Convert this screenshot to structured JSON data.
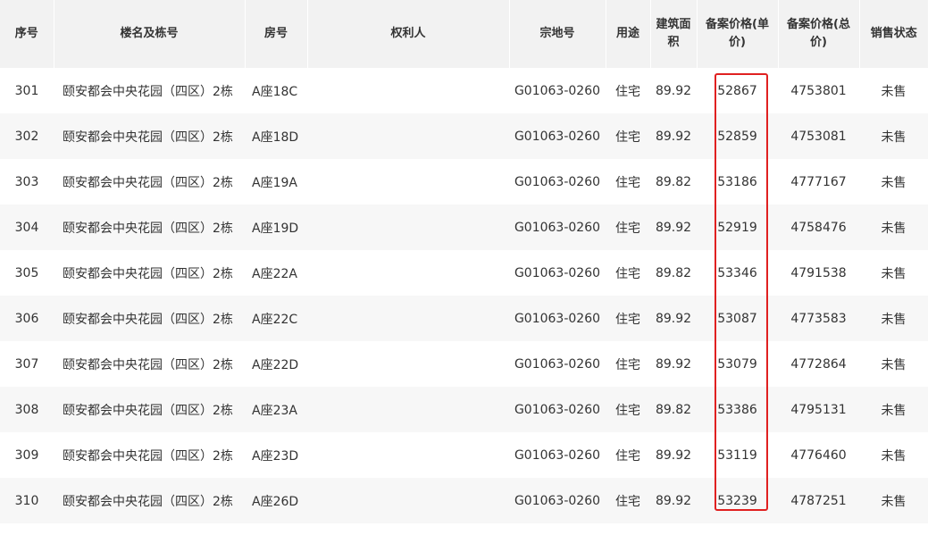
{
  "table": {
    "headers": {
      "seq": "序号",
      "building": "楼名及栋号",
      "room": "房号",
      "owner": "权利人",
      "parcel": "宗地号",
      "usage": "用途",
      "area": "建筑面积",
      "unit_price": "备案价格(单价)",
      "total_price": "备案价格(总价)",
      "status": "销售状态"
    },
    "rows": [
      {
        "seq": "301",
        "building": "颐安都会中央花园（四区）2栋",
        "room": "A座18C",
        "owner": "",
        "parcel": "G01063-0260",
        "usage": "住宅",
        "area": "89.92",
        "unit_price": "52867",
        "total_price": "4753801",
        "status": "未售"
      },
      {
        "seq": "302",
        "building": "颐安都会中央花园（四区）2栋",
        "room": "A座18D",
        "owner": "",
        "parcel": "G01063-0260",
        "usage": "住宅",
        "area": "89.92",
        "unit_price": "52859",
        "total_price": "4753081",
        "status": "未售"
      },
      {
        "seq": "303",
        "building": "颐安都会中央花园（四区）2栋",
        "room": "A座19A",
        "owner": "",
        "parcel": "G01063-0260",
        "usage": "住宅",
        "area": "89.82",
        "unit_price": "53186",
        "total_price": "4777167",
        "status": "未售"
      },
      {
        "seq": "304",
        "building": "颐安都会中央花园（四区）2栋",
        "room": "A座19D",
        "owner": "",
        "parcel": "G01063-0260",
        "usage": "住宅",
        "area": "89.92",
        "unit_price": "52919",
        "total_price": "4758476",
        "status": "未售"
      },
      {
        "seq": "305",
        "building": "颐安都会中央花园（四区）2栋",
        "room": "A座22A",
        "owner": "",
        "parcel": "G01063-0260",
        "usage": "住宅",
        "area": "89.82",
        "unit_price": "53346",
        "total_price": "4791538",
        "status": "未售"
      },
      {
        "seq": "306",
        "building": "颐安都会中央花园（四区）2栋",
        "room": "A座22C",
        "owner": "",
        "parcel": "G01063-0260",
        "usage": "住宅",
        "area": "89.92",
        "unit_price": "53087",
        "total_price": "4773583",
        "status": "未售"
      },
      {
        "seq": "307",
        "building": "颐安都会中央花园（四区）2栋",
        "room": "A座22D",
        "owner": "",
        "parcel": "G01063-0260",
        "usage": "住宅",
        "area": "89.92",
        "unit_price": "53079",
        "total_price": "4772864",
        "status": "未售"
      },
      {
        "seq": "308",
        "building": "颐安都会中央花园（四区）2栋",
        "room": "A座23A",
        "owner": "",
        "parcel": "G01063-0260",
        "usage": "住宅",
        "area": "89.82",
        "unit_price": "53386",
        "total_price": "4795131",
        "status": "未售"
      },
      {
        "seq": "309",
        "building": "颐安都会中央花园（四区）2栋",
        "room": "A座23D",
        "owner": "",
        "parcel": "G01063-0260",
        "usage": "住宅",
        "area": "89.92",
        "unit_price": "53119",
        "total_price": "4776460",
        "status": "未售"
      },
      {
        "seq": "310",
        "building": "颐安都会中央花园（四区）2栋",
        "room": "A座26D",
        "owner": "",
        "parcel": "G01063-0260",
        "usage": "住宅",
        "area": "89.92",
        "unit_price": "53239",
        "total_price": "4787251",
        "status": "未售"
      }
    ]
  },
  "colors": {
    "header_bg": "#f2f2f2",
    "stripe_bg": "#f7f7f7",
    "highlight_border": "#e02020",
    "text": "#333333"
  }
}
